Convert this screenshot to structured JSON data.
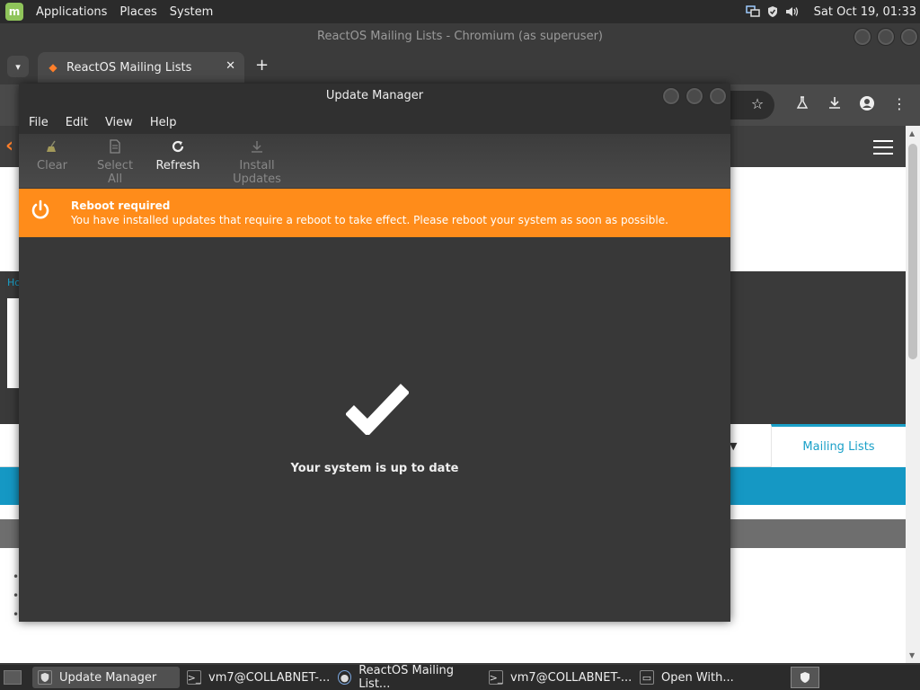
{
  "top_panel": {
    "menu": [
      "Applications",
      "Places",
      "System"
    ],
    "clock": "Sat Oct 19, 01:33",
    "tray_icons": [
      "network-icon",
      "shield-icon",
      "volume-icon"
    ]
  },
  "browser": {
    "window_title": "ReactOS Mailing Lists - Chromium (as superuser)",
    "tab_title": "ReactOS Mailing Lists",
    "tab_close": "✕",
    "new_tab": "+",
    "page": {
      "crumb": "Ho",
      "mailing_tab": "Mailing Lists",
      "dropdown_arrow": "▼"
    }
  },
  "update_manager": {
    "title": "Update Manager",
    "menu": [
      "File",
      "Edit",
      "View",
      "Help"
    ],
    "toolbar": {
      "clear": "Clear",
      "select_all": "Select All",
      "refresh": "Refresh",
      "install_updates": "Install Updates"
    },
    "banner": {
      "title": "Reboot required",
      "message": "You have installed updates that require a reboot to take effect. Please reboot your system as soon as possible.",
      "color": "#ff8c1a"
    },
    "status": "Your system is up to date"
  },
  "taskbar": {
    "tasks": [
      "Update Manager",
      "vm7@COLLABNET-...",
      "ReactOS Mailing List...",
      "vm7@COLLABNET-...",
      "Open With..."
    ]
  }
}
